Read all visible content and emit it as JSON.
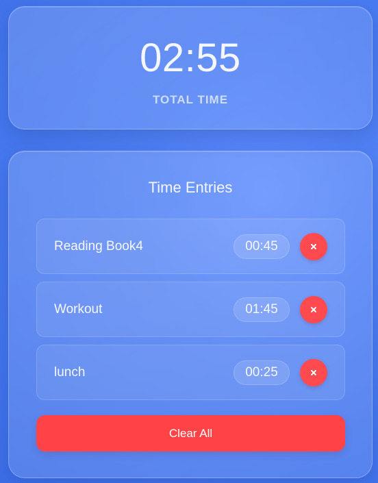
{
  "summary": {
    "total_time": "02:55",
    "label": "TOTAL TIME"
  },
  "entries_section": {
    "title": "Time Entries",
    "items": [
      {
        "name": "Reading Book4",
        "duration": "00:45",
        "delete_icon": "close-icon"
      },
      {
        "name": "Workout",
        "duration": "01:45",
        "delete_icon": "close-icon"
      },
      {
        "name": "lunch",
        "duration": "00:25",
        "delete_icon": "close-icon"
      }
    ],
    "clear_all_label": "Clear All"
  },
  "colors": {
    "background": "#4f80f4",
    "danger": "#ff4b4f",
    "text": "#f4f7ff"
  }
}
